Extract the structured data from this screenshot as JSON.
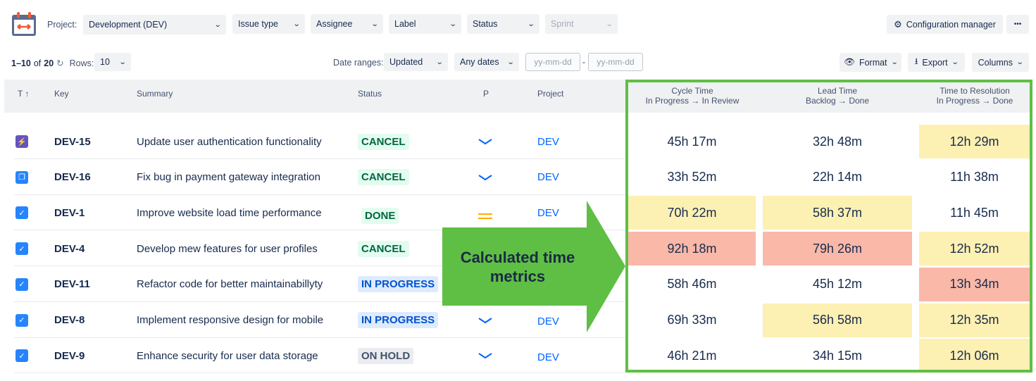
{
  "toolbar": {
    "project_label": "Project:",
    "project_value": "Development (DEV)",
    "filters": [
      "Issue type",
      "Assignee",
      "Label",
      "Status",
      "Sprint"
    ],
    "config_button": "Configuration manager",
    "more_button": "•••"
  },
  "pager": {
    "range": "1–10",
    "of": "of",
    "total": "20",
    "rows_label": "Rows:",
    "rows_value": "10"
  },
  "dates": {
    "label": "Date ranges:",
    "field": "Updated",
    "range": "Any dates",
    "from_placeholder": "yy-mm-dd",
    "sep": "-",
    "to_placeholder": "yy-mm-dd"
  },
  "actions": {
    "format": "Format",
    "export": "Export",
    "columns": "Columns"
  },
  "columns": {
    "type": "T",
    "sort": "↑",
    "key": "Key",
    "summary": "Summary",
    "status": "Status",
    "priority": "P",
    "project": "Project"
  },
  "metric_columns": [
    {
      "title": "Cycle Time",
      "sub": "In Progress → In Review"
    },
    {
      "title": "Lead Time",
      "sub": "Backlog → Done"
    },
    {
      "title": "Time to Resolution",
      "sub": "In Progress → Done"
    }
  ],
  "colors": {
    "yellow": "#fdf0b3",
    "red": "#f9b8a8",
    "green": "#5fbf45"
  },
  "rows": [
    {
      "type": "epic",
      "key": "DEV-15",
      "summary": "Update user authentication functionality",
      "status": "CANCEL",
      "status_kind": "green",
      "priority": "low",
      "project": "DEV",
      "metrics": [
        {
          "v": "45h 17m",
          "h": ""
        },
        {
          "v": "32h 48m",
          "h": ""
        },
        {
          "v": "12h 29m",
          "h": "yellow"
        }
      ]
    },
    {
      "type": "subtask",
      "key": "DEV-16",
      "summary": "Fix bug in payment gateway integration",
      "status": "CANCEL",
      "status_kind": "green",
      "priority": "low",
      "project": "DEV",
      "metrics": [
        {
          "v": "33h 52m",
          "h": ""
        },
        {
          "v": "22h 14m",
          "h": ""
        },
        {
          "v": "11h 38m",
          "h": ""
        }
      ]
    },
    {
      "type": "task",
      "key": "DEV-1",
      "summary": "Improve website load time performance",
      "status": "DONE",
      "status_kind": "green",
      "priority": "medium",
      "project": "DEV",
      "metrics": [
        {
          "v": "70h 22m",
          "h": "yellow"
        },
        {
          "v": "58h 37m",
          "h": "yellow"
        },
        {
          "v": "11h 45m",
          "h": ""
        }
      ]
    },
    {
      "type": "task",
      "key": "DEV-4",
      "summary": "Develop mew features for user profiles",
      "status": "CANCEL",
      "status_kind": "green",
      "priority": "",
      "project": "",
      "metrics": [
        {
          "v": "92h 18m",
          "h": "red"
        },
        {
          "v": "79h 26m",
          "h": "red"
        },
        {
          "v": "12h 52m",
          "h": "yellow"
        }
      ]
    },
    {
      "type": "task",
      "key": "DEV-11",
      "summary": "Refactor code for better maintainabillyty",
      "status": "IN PROGRESS",
      "status_kind": "blue",
      "priority": "",
      "project": "",
      "metrics": [
        {
          "v": "58h 46m",
          "h": ""
        },
        {
          "v": "45h 12m",
          "h": ""
        },
        {
          "v": "13h 34m",
          "h": "red"
        }
      ]
    },
    {
      "type": "task",
      "key": "DEV-8",
      "summary": "Implement responsive design for mobile",
      "status": "IN PROGRESS",
      "status_kind": "blue",
      "priority": "low",
      "project": "DEV",
      "metrics": [
        {
          "v": "69h 33m",
          "h": ""
        },
        {
          "v": "56h 58m",
          "h": "yellow"
        },
        {
          "v": "12h 35m",
          "h": "yellow"
        }
      ]
    },
    {
      "type": "task",
      "key": "DEV-9",
      "summary": "Enhance security for user data storage",
      "status": "ON HOLD",
      "status_kind": "gray",
      "priority": "low",
      "project": "DEV",
      "metrics": [
        {
          "v": "46h 21m",
          "h": ""
        },
        {
          "v": "34h 15m",
          "h": ""
        },
        {
          "v": "12h 06m",
          "h": "yellow"
        }
      ]
    }
  ],
  "callout": {
    "text": "Calculated time metrics"
  }
}
